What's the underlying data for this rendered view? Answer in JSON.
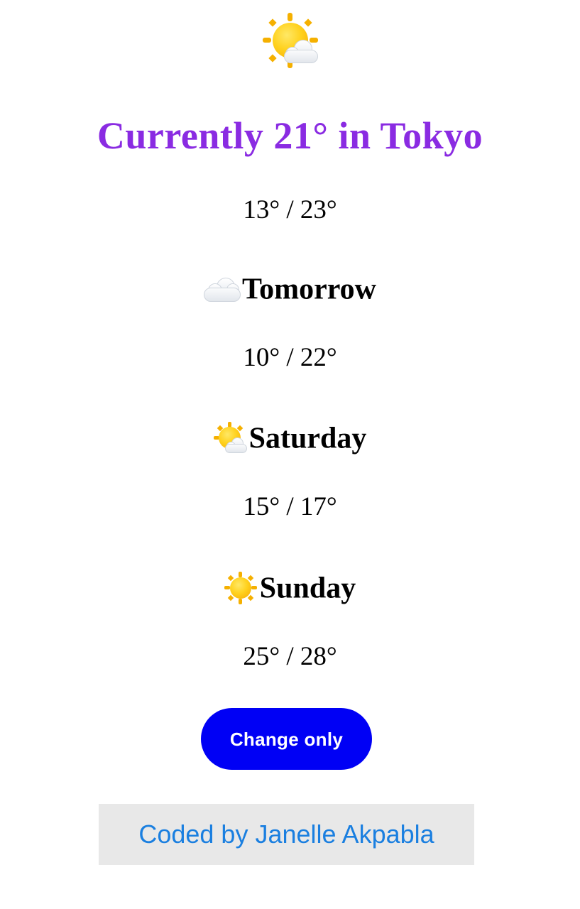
{
  "current": {
    "icon": "sun-behind-cloud-icon",
    "title": "Currently 21° in Tokyo",
    "range": "13° / 23°"
  },
  "forecast": [
    {
      "icon": "cloud-icon",
      "day": "Tomorrow",
      "range": "10° / 22°"
    },
    {
      "icon": "sun-behind-cloud-icon",
      "day": "Saturday",
      "range": "15° / 17°"
    },
    {
      "icon": "sun-icon",
      "day": "Sunday",
      "range": "25° / 28°"
    }
  ],
  "button": {
    "label": "Change only"
  },
  "footer": {
    "text": "Coded by Janelle Akpabla"
  },
  "colors": {
    "title": "#8a2be2",
    "button_bg": "#0000f5",
    "link": "#1a7fe0",
    "footer_bg": "#e8e8e8"
  }
}
